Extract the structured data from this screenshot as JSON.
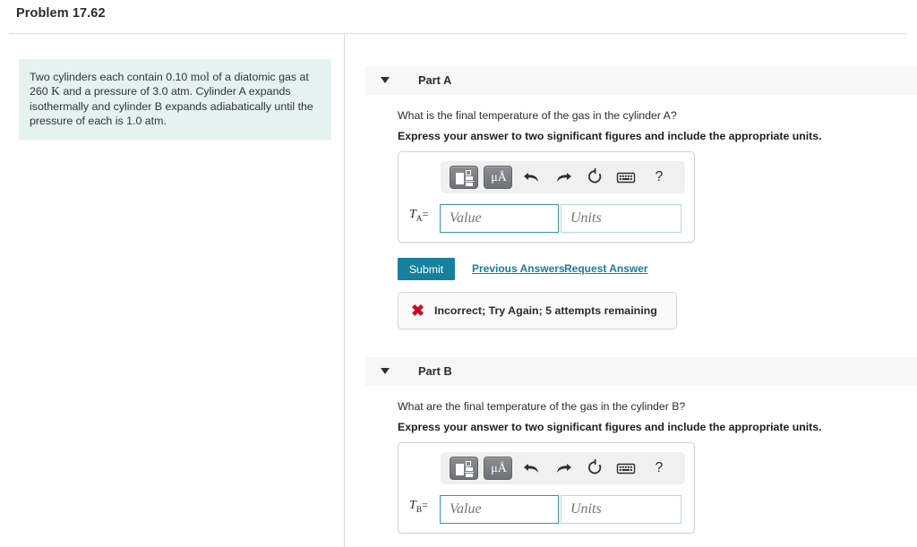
{
  "header": {
    "title": "Problem 17.62"
  },
  "problem": {
    "text_part1": "Two cylinders each contain 0.10 ",
    "math_mol": "mol",
    "text_part2": " of a diatomic gas at 260 ",
    "math_k": "K",
    "text_part3": " and a pressure of 3.0 atm. Cylinder A expands isothermally and cylinder B expands adiabatically until the pressure of each is 1.0 atm."
  },
  "toolbar": {
    "template_icon": "math-template-icon",
    "units_icon": "μÅ",
    "undo_icon": "undo-icon",
    "redo_icon": "redo-icon",
    "reset_icon": "reset-icon",
    "keyboard_icon": "keyboard-icon",
    "help_icon": "?"
  },
  "parts": [
    {
      "id": "part-a",
      "label": "Part A",
      "caret": "chevron-down-icon",
      "question": "What is the final temperature of the gas in the cylinder A?",
      "instruction": "Express your answer to two significant figures and include the appropriate units.",
      "field_symbol": "T",
      "field_subscript": "A",
      "field_equals": "=",
      "value_placeholder": "Value",
      "value_text": "",
      "units_placeholder": "Units",
      "units_text": "",
      "submit_label": "Submit",
      "previous_answers_label": "Previous Answers",
      "request_answer_label": "Request Answer",
      "feedback": {
        "icon": "✖",
        "text": "Incorrect; Try Again; 5 attempts remaining"
      }
    },
    {
      "id": "part-b",
      "label": "Part B",
      "caret": "chevron-down-icon",
      "question": "What are the final temperature of the gas in the cylinder B?",
      "instruction": "Express your answer to two significant figures and include the appropriate units.",
      "field_symbol": "T",
      "field_subscript": "B",
      "field_equals": "=",
      "value_placeholder": "Value",
      "value_text": "",
      "units_placeholder": "Units",
      "units_text": ""
    }
  ],
  "colors": {
    "accent_teal": "#17809e",
    "link_teal": "#1a7d9c",
    "problem_bg": "#e4f2f0",
    "band_bg": "#f7f7f7",
    "error_red": "#cf0a1d",
    "focus_border": "#3b93ab"
  }
}
